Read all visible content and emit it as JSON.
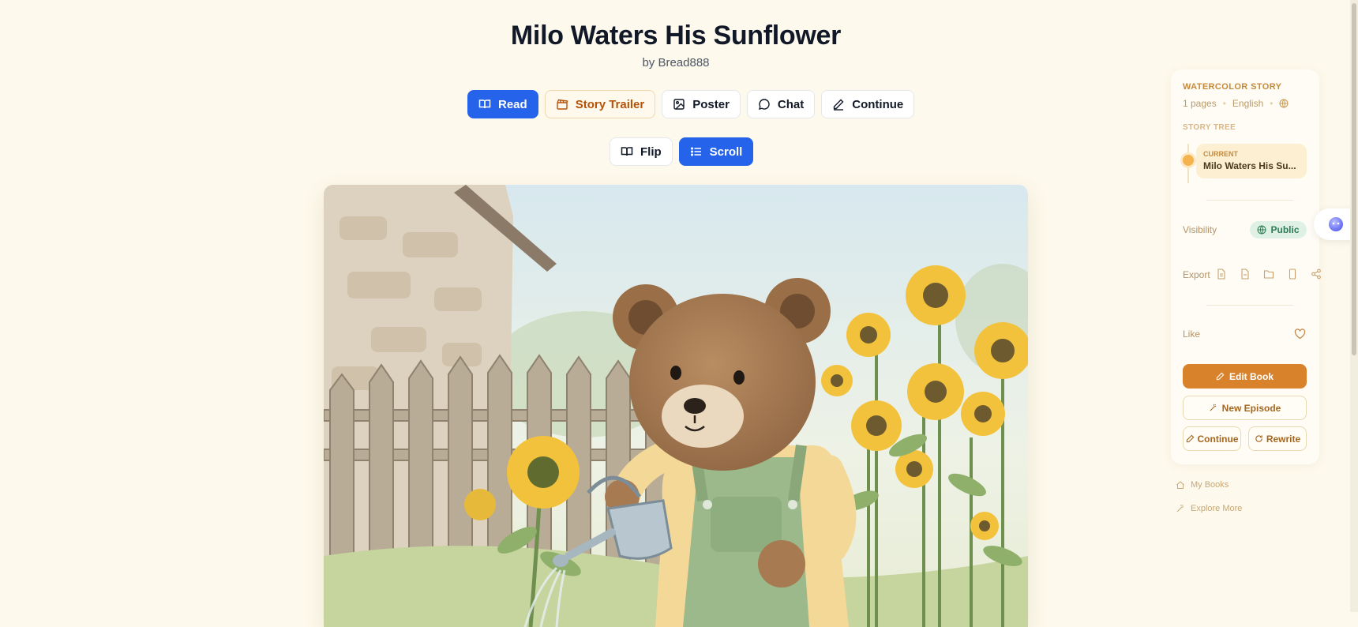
{
  "book": {
    "title": "Milo Waters His Sunflower",
    "author": "by Bread888"
  },
  "actions": [
    {
      "label": "Read",
      "icon": "book-open-icon",
      "active": true
    },
    {
      "label": "Story Trailer",
      "icon": "clapperboard-icon",
      "active": false
    },
    {
      "label": "Poster",
      "icon": "image-icon",
      "active": false
    },
    {
      "label": "Chat",
      "icon": "chat-bubble-icon",
      "active": false
    },
    {
      "label": "Continue",
      "icon": "pencil-icon",
      "active": false
    }
  ],
  "view_modes": [
    {
      "label": "Flip",
      "icon": "book-open-icon",
      "active": false
    },
    {
      "label": "Scroll",
      "icon": "list-icon",
      "active": true
    }
  ],
  "sidebar": {
    "story_type": "WATERCOLOR STORY",
    "pages": "1 pages",
    "language": "English",
    "story_tree_label": "STORY TREE",
    "current_label": "CURRENT",
    "current_title": "Milo Waters His Su...",
    "visibility_label": "Visibility",
    "visibility_value": "Public",
    "export_label": "Export",
    "like_label": "Like",
    "edit_book": "Edit Book",
    "new_episode": "New Episode",
    "continue": "Continue",
    "rewrite": "Rewrite"
  },
  "links": {
    "my_books": "My Books",
    "explore_more": "Explore More"
  },
  "colors": {
    "accent": "#2563eb",
    "brand": "#d8822c",
    "background": "#fdf9ec"
  }
}
